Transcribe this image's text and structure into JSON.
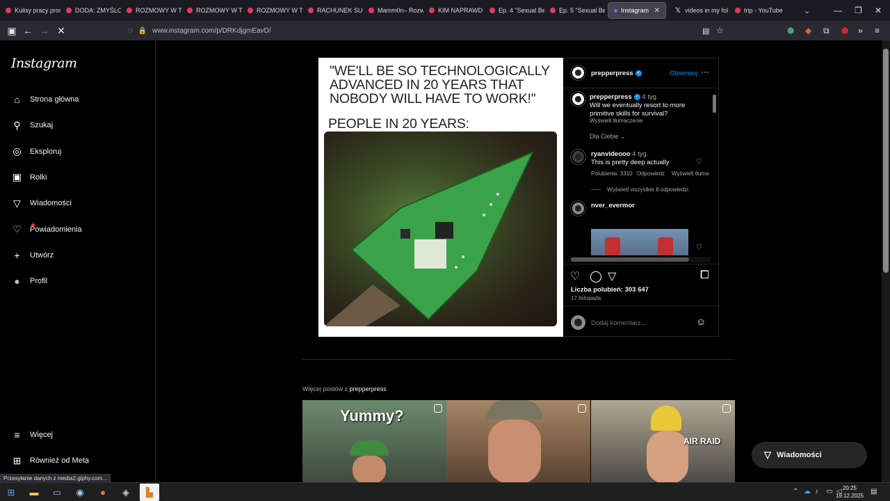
{
  "browser": {
    "tabs": [
      {
        "label": "Kulisy pracy pros",
        "active": false
      },
      {
        "label": "DODA: ZMYŚLO",
        "active": false
      },
      {
        "label": "ROZMOWY W T",
        "active": false
      },
      {
        "label": "ROZMOWY W T",
        "active": false
      },
      {
        "label": "ROZMOWY W T",
        "active": false
      },
      {
        "label": "RACHUNEK SUM",
        "active": false
      },
      {
        "label": "Mamm0n– Rozw",
        "active": false
      },
      {
        "label": "KIM NAPRAWD",
        "active": false
      },
      {
        "label": "Ep. 4 \"Sexual Be",
        "active": false
      },
      {
        "label": "Ep. 5 \"Sexual Be",
        "active": false
      },
      {
        "label": "Instagram",
        "active": true
      },
      {
        "label": "videos in my fol",
        "active": false
      },
      {
        "label": "trip - YouTube",
        "active": false
      }
    ],
    "url": "www.instagram.com/p/DRKdjgmEavD/",
    "status_text": "Przesyłanie danych z media2.giphy.com..."
  },
  "sidebar": {
    "logo": "Instagram",
    "items": [
      {
        "label": "Strona główna",
        "icon": "home-icon"
      },
      {
        "label": "Szukaj",
        "icon": "search-icon"
      },
      {
        "label": "Eksploruj",
        "icon": "compass-icon"
      },
      {
        "label": "Rolki",
        "icon": "reels-icon"
      },
      {
        "label": "Wiadomości",
        "icon": "messenger-icon"
      },
      {
        "label": "Powiadomienia",
        "icon": "heart-icon"
      },
      {
        "label": "Utwórz",
        "icon": "plus-icon"
      },
      {
        "label": "Profil",
        "icon": "profile-icon"
      }
    ],
    "more": "Więcej",
    "meta": "Również od Meta"
  },
  "post": {
    "meme_line1": "\"WE'LL BE SO TECHNOLOGICALLY ADVANCED IN 20 YEARS THAT NOBODY WILL HAVE TO WORK!\"",
    "meme_line2": "PEOPLE IN 20 YEARS:",
    "author": "prepperpress",
    "follow": "Obserwuj",
    "caption_user": "prepperpress",
    "caption_time": "4 tyg.",
    "caption_text1": "Will we eventually resort to more",
    "caption_text2": "primitive skills for survival?",
    "translate": "Wyświetl tłumaczenie",
    "sort": "Dla Ciebie",
    "comments": [
      {
        "user": "ryanvideooo",
        "time": "4 tyg.",
        "text": "This is pretty deep actually",
        "likes": "Polubienia: 3310",
        "reply": "Odpowiedz",
        "translate": "Wyświetl tłuma",
        "view_replies": "Wyświetl wszystkie 8 odpowiedzi"
      },
      {
        "user": "nver_evermor"
      }
    ],
    "likes": "Liczba polubień: 303 647",
    "date": "17 listopada",
    "add_comment_placeholder": "Dodaj komentarz..."
  },
  "more_posts": {
    "label_prefix": "Więcej postów z",
    "label_user": "prepperpress",
    "thumb1_text": "Yummy?",
    "thumb3_text": "AIR RAID"
  },
  "messages_pill": "Wiadomości",
  "taskbar": {
    "time": "20:25",
    "date": "19.12.2025"
  }
}
